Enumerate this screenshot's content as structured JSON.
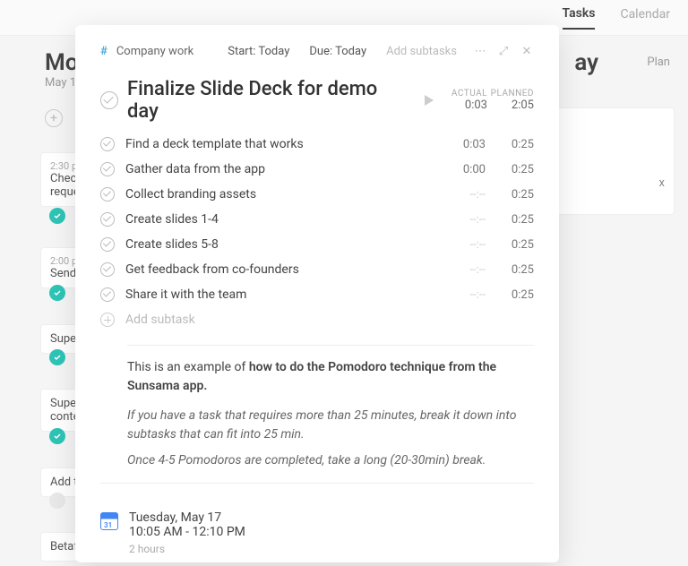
{
  "header": {
    "tabs": {
      "tasks": "Tasks",
      "calendar": "Calendar"
    }
  },
  "background": {
    "day": "Mo",
    "date": "May 1",
    "day_right": "ay",
    "plan": "Plan",
    "tasks": {
      "t1_time": "2:30 p",
      "t1_title": "Chec",
      "t1_sub": "reque",
      "t2_time": "2:00 p",
      "t2_title": "Send",
      "t3_title": "Supe",
      "t4_title": "Supe",
      "t4_sub": "conte",
      "t5_title": "Add t",
      "t6_title": "Betaf"
    }
  },
  "modal": {
    "workspace": "Company work",
    "start": "Start: Today",
    "due": "Due: Today",
    "add_subtasks_link": "Add subtasks",
    "title": "Finalize Slide Deck for demo day",
    "headers": {
      "actual": "ACTUAL",
      "planned": "PLANNED"
    },
    "totals": {
      "actual": "0:03",
      "planned": "2:05"
    },
    "subtasks": [
      {
        "name": "Find a deck template that works",
        "actual": "0:03",
        "planned": "0:25"
      },
      {
        "name": "Gather data from the app",
        "actual": "0:00",
        "planned": "0:25"
      },
      {
        "name": "Collect branding assets",
        "actual": "--:--",
        "planned": "0:25"
      },
      {
        "name": "Create slides 1-4",
        "actual": "--:--",
        "planned": "0:25"
      },
      {
        "name": "Create slides 5-8",
        "actual": "--:--",
        "planned": "0:25"
      },
      {
        "name": "Get feedback from co-founders",
        "actual": "--:--",
        "planned": "0:25"
      },
      {
        "name": "Share it with the team",
        "actual": "--:--",
        "planned": "0:25"
      }
    ],
    "add_subtask": "Add subtask",
    "note_prefix": "This is an example of ",
    "note_bold": "how to do the Pomodoro technique from the Sunsama app.",
    "note_line2": "If you have a task that requires more than 25 minutes, break it down into subtasks that can fit into 25 min.",
    "note_line3": "Once 4-5 Pomodoros are completed, take a long (20-30min) break.",
    "schedule": {
      "date": "Tuesday, May 17",
      "time": "10:05 AM - 12:10 PM",
      "duration": "2 hours"
    }
  }
}
